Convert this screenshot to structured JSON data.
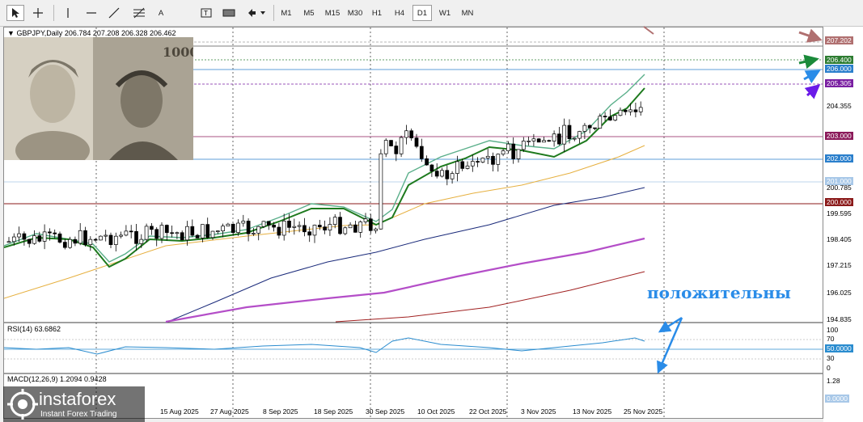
{
  "toolbar": {
    "tools": [
      "cursor-icon",
      "crosshair-icon",
      "vertical-line-icon",
      "horizontal-line-icon",
      "trendline-icon",
      "fibonacci-icon",
      "text-icon",
      "label-icon",
      "rectangle-icon",
      "arrows-icon"
    ],
    "text_tool": "A",
    "timeframes": [
      "M1",
      "M5",
      "M15",
      "M30",
      "H1",
      "H4",
      "D1",
      "W1",
      "MN"
    ],
    "active_timeframe": "D1"
  },
  "chart_header": {
    "symbol": "GBPJPY,Daily",
    "open": "206.784",
    "high": "207.208",
    "low": "206.328",
    "close": "206.462"
  },
  "overlay_text": "положительны",
  "rsi": {
    "label": "RSI(14) 63.6862",
    "levels": [
      "100",
      "70",
      "50",
      "30",
      "0"
    ],
    "level_box": "50.0000"
  },
  "macd": {
    "label": "MACD(12,26,9) 1.2094 0.9428",
    "scale_top": "1.28",
    "level_box": "0.0000"
  },
  "price_scale": {
    "ticks": [
      "204.355",
      "199.595",
      "198.405",
      "197.215",
      "196.025",
      "194.835",
      "200.785"
    ],
    "boxes": [
      {
        "value": "207.202",
        "color": "#b07070"
      },
      {
        "value": "206.400",
        "color": "#2e7d32"
      },
      {
        "value": "206.000",
        "color": "#2a7fcc"
      },
      {
        "value": "205.305",
        "color": "#7a1fa2"
      },
      {
        "value": "203.000",
        "color": "#8b1a5a"
      },
      {
        "value": "202.000",
        "color": "#2a7fcc"
      },
      {
        "value": "201.000",
        "color": "#a8c8e8"
      },
      {
        "value": "200.000",
        "color": "#8b1a1a"
      }
    ]
  },
  "dates": [
    "15 Aug 2025",
    "27 Aug 2025",
    "8 Sep 2025",
    "18 Sep 2025",
    "30 Sep 2025",
    "10 Oct 2025",
    "22 Oct 2025",
    "3 Nov 2025",
    "13 Nov 2025",
    "25 Nov 2025"
  ],
  "watermark": {
    "brand": "instaforex",
    "tagline": "Instant Forex Trading"
  },
  "colors": {
    "ma_fast": "#5aaf8a",
    "ma_mid": "#1e7a1e",
    "ma_yellow": "#e6b040",
    "ma_navy": "#1a2a7a",
    "ma_violet": "#b44ec8",
    "ma_darkred": "#a02020",
    "rsi_line": "#2a8ccf",
    "arrow_blue": "#2a8ce8"
  }
}
